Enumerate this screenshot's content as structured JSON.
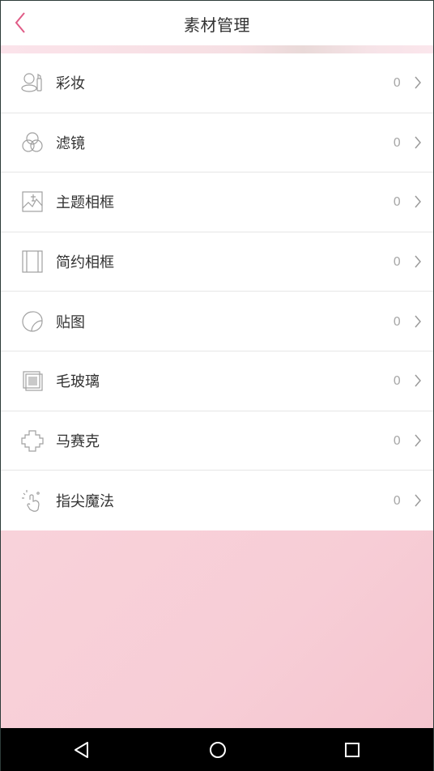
{
  "header": {
    "title": "素材管理",
    "back_icon": "chevron-left-icon"
  },
  "colors": {
    "accent": "#e05b86",
    "text": "#333333",
    "muted": "#a9a9a9",
    "pink_background": "#f7cdd6",
    "navbar": "#000000"
  },
  "items": [
    {
      "label": "彩妆",
      "count": "0",
      "icon": "makeup-icon"
    },
    {
      "label": "滤镜",
      "count": "0",
      "icon": "filter-icon"
    },
    {
      "label": "主题相框",
      "count": "0",
      "icon": "theme-frame-icon"
    },
    {
      "label": "简约相框",
      "count": "0",
      "icon": "simple-frame-icon"
    },
    {
      "label": "贴图",
      "count": "0",
      "icon": "sticker-icon"
    },
    {
      "label": "毛玻璃",
      "count": "0",
      "icon": "frosted-glass-icon"
    },
    {
      "label": "马赛克",
      "count": "0",
      "icon": "mosaic-icon"
    },
    {
      "label": "指尖魔法",
      "count": "0",
      "icon": "fingertip-magic-icon"
    }
  ],
  "navbar": {
    "back": "triangle-back-icon",
    "home": "circle-home-icon",
    "recents": "square-recents-icon"
  }
}
